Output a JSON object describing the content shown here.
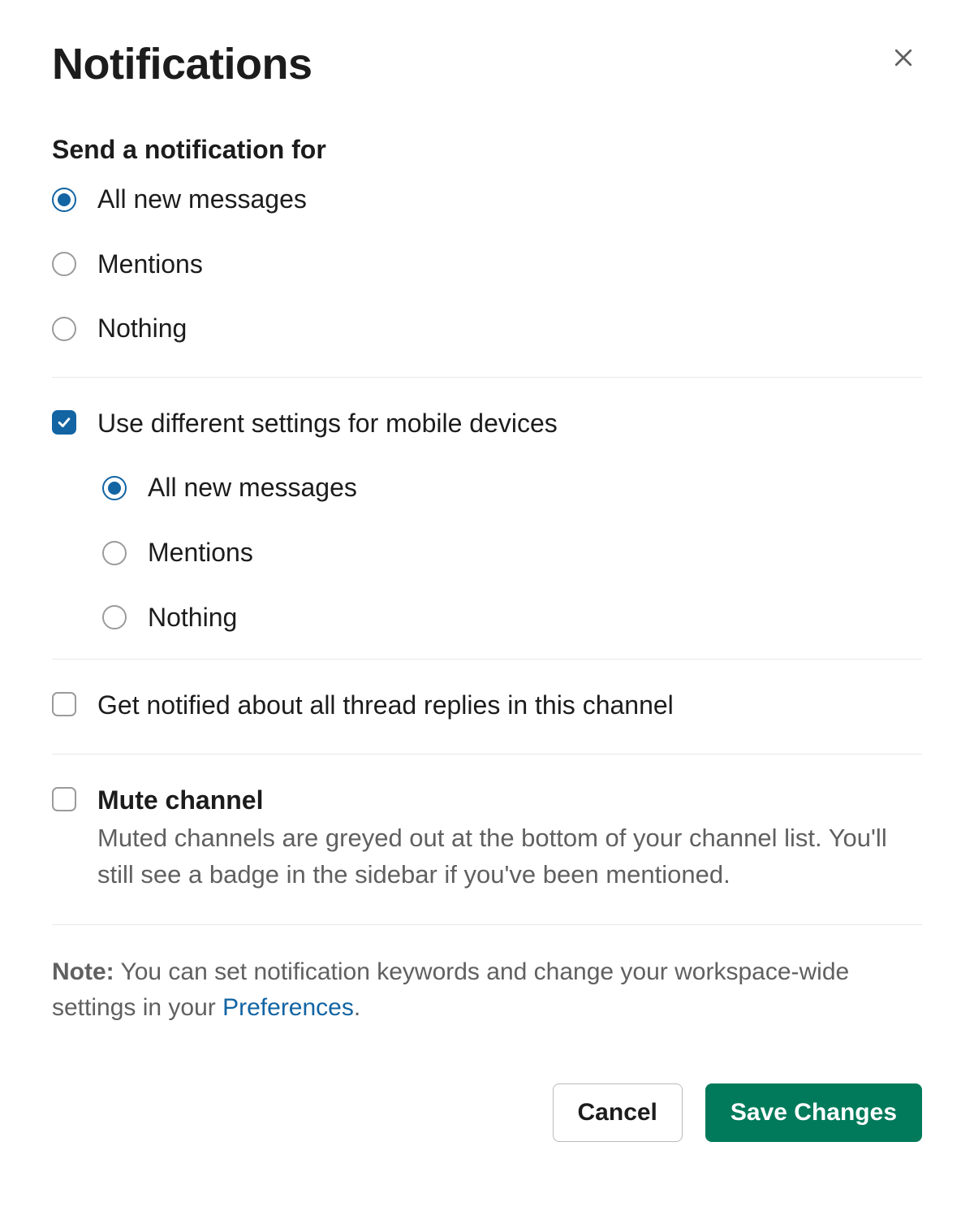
{
  "title": "Notifications",
  "section_send": {
    "heading": "Send a notification for",
    "options": {
      "all": "All new messages",
      "mentions": "Mentions",
      "nothing": "Nothing"
    },
    "selected": "all"
  },
  "mobile": {
    "checkbox_label": "Use different settings for mobile devices",
    "checked": true,
    "options": {
      "all": "All new messages",
      "mentions": "Mentions",
      "nothing": "Nothing"
    },
    "selected": "all"
  },
  "thread_replies": {
    "label": "Get notified about all thread replies in this channel",
    "checked": false
  },
  "mute": {
    "label": "Mute channel",
    "description": "Muted channels are greyed out at the bottom of your channel list. You'll still see a badge in the sidebar if you've been mentioned.",
    "checked": false
  },
  "note": {
    "bold": "Note:",
    "text_before": " You can set notification keywords and change your workspace-wide settings in your ",
    "link": "Preferences",
    "text_after": "."
  },
  "buttons": {
    "cancel": "Cancel",
    "save": "Save Changes"
  }
}
